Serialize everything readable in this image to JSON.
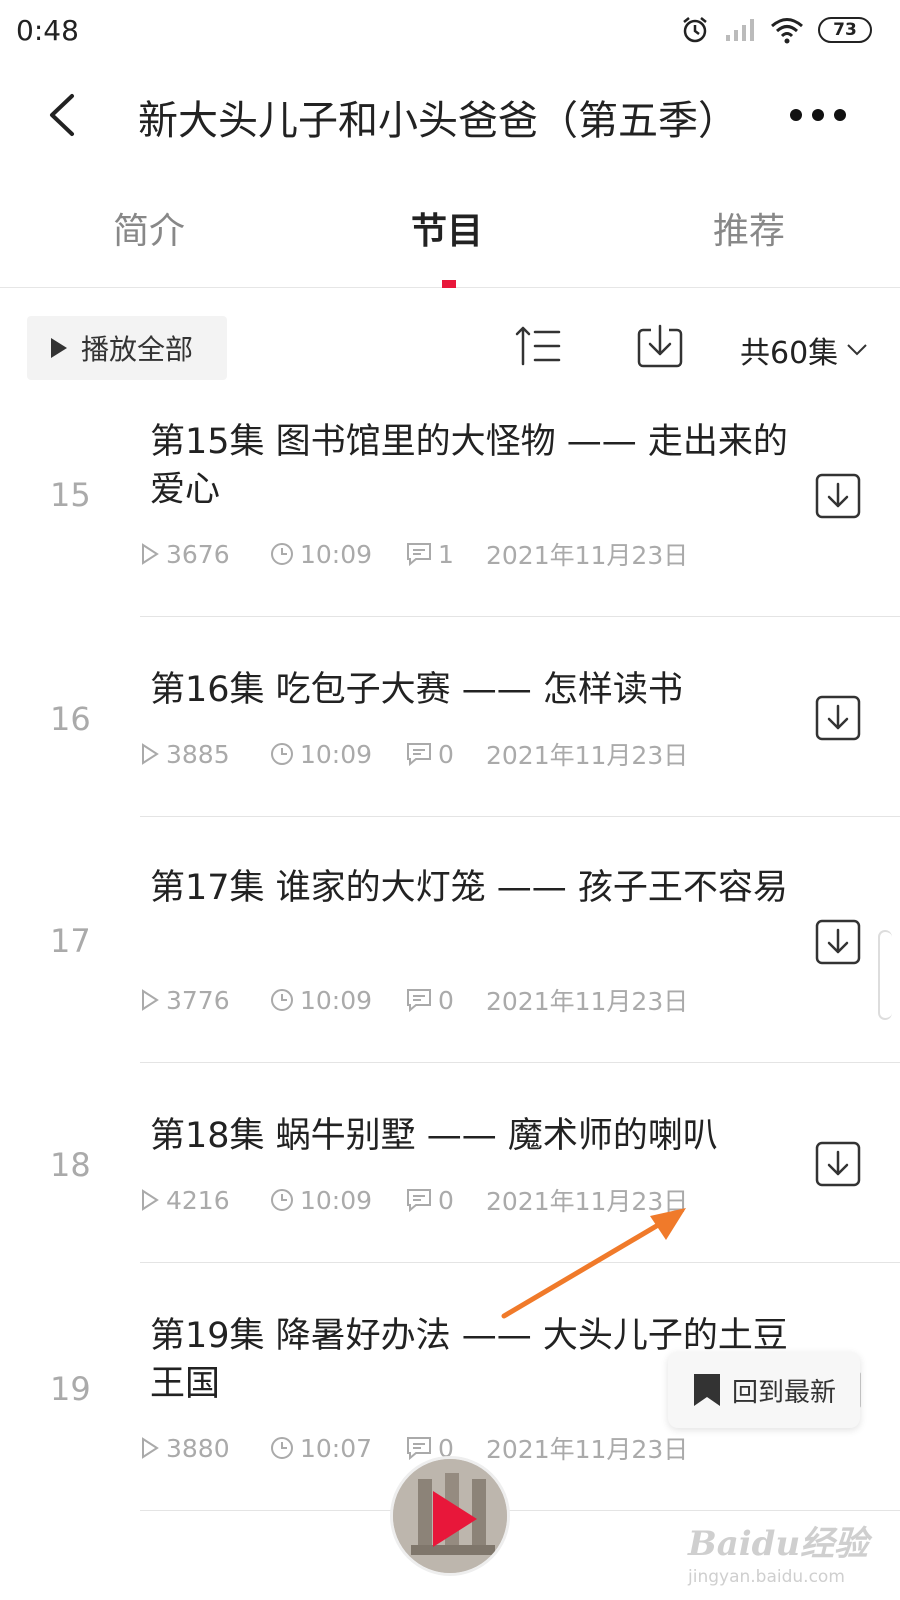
{
  "status_bar": {
    "time": "0:48",
    "battery": "73"
  },
  "header": {
    "title": "新大头儿子和小头爸爸（第五季）"
  },
  "tabs": [
    {
      "label": "简介"
    },
    {
      "label": "节目"
    },
    {
      "label": "推荐"
    }
  ],
  "toolbar": {
    "play_all": "播放全部",
    "episode_count": "共60集"
  },
  "episodes": [
    {
      "num": "15",
      "title": "第15集 图书馆里的大怪物 —— 走出来的爱心",
      "plays": "3676",
      "duration": "10:09",
      "comments": "1",
      "date": "2021年11月23日"
    },
    {
      "num": "16",
      "title": "第16集 吃包子大赛 —— 怎样读书",
      "plays": "3885",
      "duration": "10:09",
      "comments": "0",
      "date": "2021年11月23日"
    },
    {
      "num": "17",
      "title": "第17集 谁家的大灯笼 —— 孩子王不容易",
      "plays": "3776",
      "duration": "10:09",
      "comments": "0",
      "date": "2021年11月23日"
    },
    {
      "num": "18",
      "title": "第18集 蜗牛别墅 —— 魔术师的喇叭",
      "plays": "4216",
      "duration": "10:09",
      "comments": "0",
      "date": "2021年11月23日"
    },
    {
      "num": "19",
      "title": "第19集 降暑好办法 —— 大头儿子的土豆王国",
      "plays": "3880",
      "duration": "10:07",
      "comments": "0",
      "date": "2021年11月23日"
    }
  ],
  "floating": {
    "back_to_latest": "回到最新"
  },
  "watermark": {
    "logo": "Baidu经验",
    "url": "jingyan.baidu.com"
  },
  "colors": {
    "accent": "#e8173a",
    "annotation_arrow": "#f07a2a"
  }
}
